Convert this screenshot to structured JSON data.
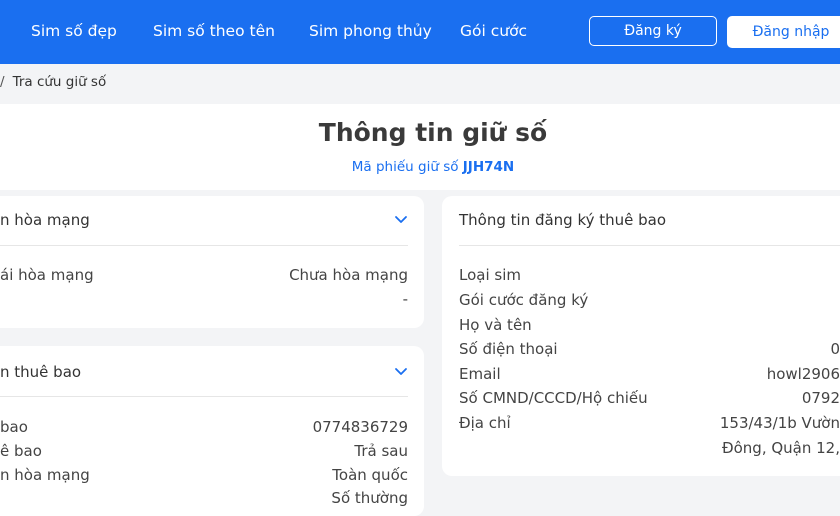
{
  "nav": {
    "items": [
      "Sim số đẹp",
      "Sim số theo tên",
      "Sim phong thủy",
      "Gói cước"
    ],
    "register_label": "Đăng ký",
    "login_label": "Đăng nhập"
  },
  "breadcrumb": {
    "separator": "/",
    "current": "Tra cứu giữ số"
  },
  "page": {
    "title": "Thông tin giữ số",
    "ticket_label": "Mã phiếu giữ số",
    "ticket_code": "JJH74N"
  },
  "activation_card": {
    "title": "n hòa mạng",
    "rows": [
      {
        "label": "ái hòa mạng",
        "value": "Chưa hòa mạng"
      },
      {
        "label": "",
        "value": "-"
      }
    ]
  },
  "subscriber_card": {
    "title": "n thuê bao",
    "rows": [
      {
        "label": "bao",
        "value": "0774836729"
      },
      {
        "label": "ê bao",
        "value": "Trả sau"
      },
      {
        "label": "n hòa mạng",
        "value": "Toàn quốc"
      },
      {
        "label": "",
        "value": "Số thường"
      }
    ]
  },
  "registration_card": {
    "title": "Thông tin đăng ký thuê bao",
    "rows": [
      {
        "label": "Loại sim",
        "value": ""
      },
      {
        "label": "Gói cước đăng ký",
        "value": ""
      },
      {
        "label": "Họ và tên",
        "value": ""
      },
      {
        "label": "Số điện thoại",
        "value": "0"
      },
      {
        "label": "Email",
        "value": "howl2906"
      },
      {
        "label": "Số CMND/CCCD/Hộ chiếu",
        "value": "0792"
      },
      {
        "label": "Địa chỉ",
        "value": "153/43/1b Vườn"
      },
      {
        "label": "",
        "value": "Đông, Quận 12,"
      }
    ]
  },
  "colors": {
    "brand": "#1a6ff0",
    "background": "#f3f4f6",
    "card": "#ffffff"
  }
}
